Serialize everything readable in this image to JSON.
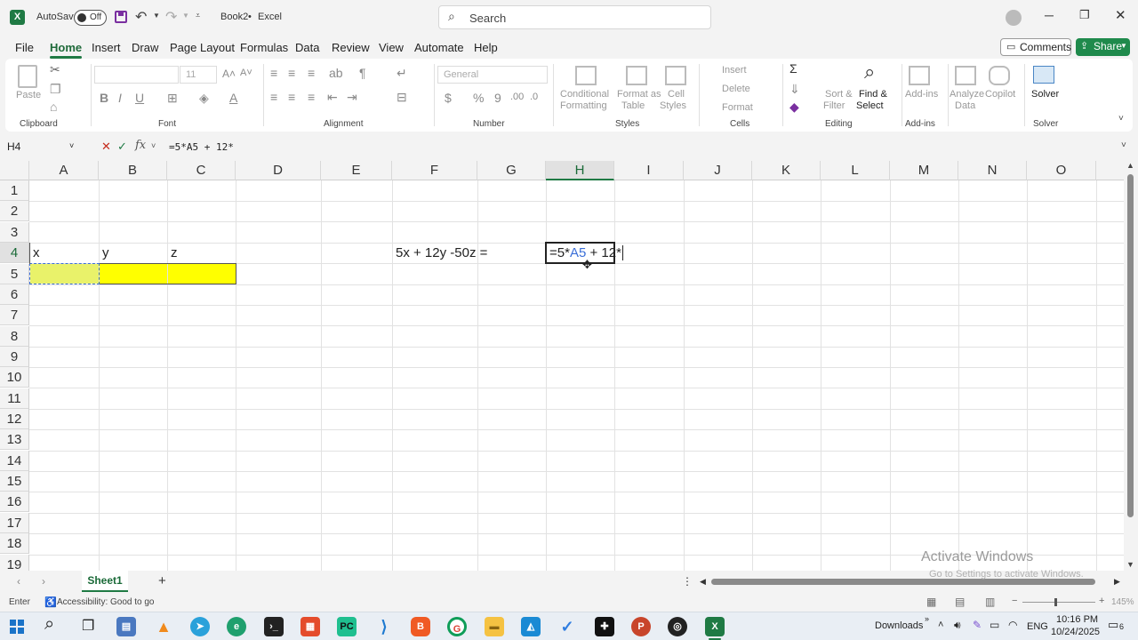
{
  "titlebar": {
    "autosave_label": "AutoSave",
    "autosave_state": "Off",
    "doc_title": "Book2",
    "separator": "•",
    "app_name": "Excel",
    "search_placeholder": "Search"
  },
  "tabs": [
    "File",
    "Home",
    "Insert",
    "Draw",
    "Page Layout",
    "Formulas",
    "Data",
    "Review",
    "View",
    "Automate",
    "Help"
  ],
  "active_tab": "Home",
  "comments_label": "Comments",
  "share_label": "Share",
  "ribbon": {
    "clipboard": {
      "paste": "Paste",
      "label": "Clipboard"
    },
    "font": {
      "name": "",
      "size": "11",
      "label": "Font"
    },
    "alignment": {
      "label": "Alignment"
    },
    "number": {
      "format": "General",
      "label": "Number"
    },
    "styles": {
      "conditional": [
        "Conditional",
        "Formatting"
      ],
      "format_table": [
        "Format as",
        "Table"
      ],
      "cell_styles": [
        "Cell",
        "Styles"
      ],
      "label": "Styles"
    },
    "cells": {
      "insert": "Insert",
      "delete": "Delete",
      "format": "Format",
      "label": "Cells"
    },
    "editing": {
      "sort": [
        "Sort &",
        "Filter"
      ],
      "find": [
        "Find &",
        "Select"
      ],
      "label": "Editing"
    },
    "addins": {
      "addins": [
        "Add-ins"
      ],
      "label": "Add-ins"
    },
    "analyze": [
      "Analyze",
      "Data"
    ],
    "copilot": "Copilot",
    "solver": {
      "name": "Solver",
      "label": "Solver"
    }
  },
  "formula_bar": {
    "name_box": "H4",
    "content": "=5*A5 + 12*"
  },
  "columns": [
    "A",
    "B",
    "C",
    "D",
    "E",
    "F",
    "G",
    "H",
    "I",
    "J",
    "K",
    "L",
    "M",
    "N",
    "O"
  ],
  "rows": [
    "1",
    "2",
    "3",
    "4",
    "5",
    "6",
    "7",
    "8",
    "9",
    "10",
    "11",
    "12",
    "13",
    "14",
    "15",
    "16",
    "17",
    "18",
    "19"
  ],
  "cells": {
    "A4": "x",
    "B4": "y",
    "C4": "z",
    "F4": "5x + 12y -50z =",
    "H4_prefix": "=5*",
    "H4_ref": "A5",
    "H4_suffix": " + 12*"
  },
  "colors": {
    "highlight": "#ffff00",
    "excel_green": "#1f7a44",
    "ref_blue": "#3b6fd8"
  },
  "sheet_tabs": [
    "Sheet1"
  ],
  "status": {
    "mode": "Enter",
    "accessibility": "Accessibility: Good to go",
    "zoom": "145%"
  },
  "watermark": {
    "line1": "Activate Windows",
    "line2": "Go to Settings to activate Windows."
  },
  "taskbar": {
    "downloads": "Downloads",
    "lang": "ENG",
    "time": "10:16 PM",
    "date": "10/24/2025",
    "notif": "6"
  }
}
